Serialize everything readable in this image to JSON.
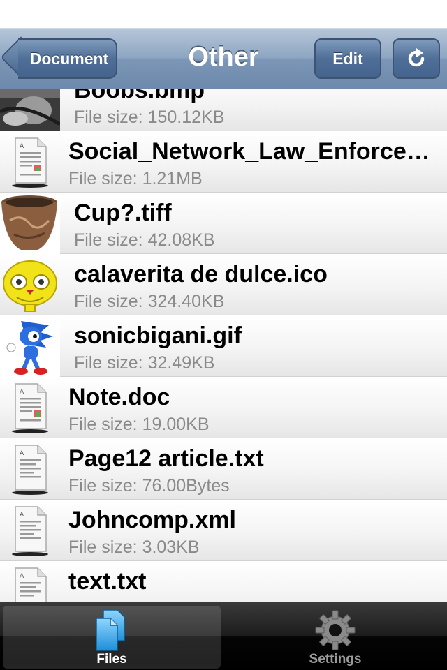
{
  "navbar": {
    "title": "Other",
    "back_label": "Document",
    "edit_label": "Edit",
    "refresh_icon": "refresh-icon"
  },
  "files": [
    {
      "name": "Boobs.bmp",
      "size": "File size: 150.12KB",
      "thumb": "photo-thumbnail"
    },
    {
      "name": "Social_Network_Law_Enforcement_Guide.pdf",
      "size": "File size: 1.21MB",
      "thumb": "document-icon"
    },
    {
      "name": "Cup?.tiff",
      "size": "File size: 42.08KB",
      "thumb": "cup-thumbnail"
    },
    {
      "name": "calaverita de dulce.ico",
      "size": "File size: 324.40KB",
      "thumb": "skull-thumbnail"
    },
    {
      "name": "sonicbigani.gif",
      "size": "File size: 32.49KB",
      "thumb": "sonic-thumbnail"
    },
    {
      "name": "Note.doc",
      "size": "File size: 19.00KB",
      "thumb": "document-icon"
    },
    {
      "name": "Page12 article.txt",
      "size": "File size: 76.00Bytes",
      "thumb": "text-file-icon"
    },
    {
      "name": "Johncomp.xml",
      "size": "File size: 3.03KB",
      "thumb": "text-file-icon"
    },
    {
      "name": "text.txt",
      "size": "",
      "thumb": "text-file-icon"
    }
  ],
  "tabbar": {
    "tabs": [
      {
        "label": "Files",
        "icon": "files-icon",
        "selected": true
      },
      {
        "label": "Settings",
        "icon": "gear-icon",
        "selected": false
      }
    ]
  },
  "colors": {
    "navbar": "#7b96b6",
    "tabbar": "#1c1c1c",
    "selected_tab_icon": "#3aa8e8"
  }
}
